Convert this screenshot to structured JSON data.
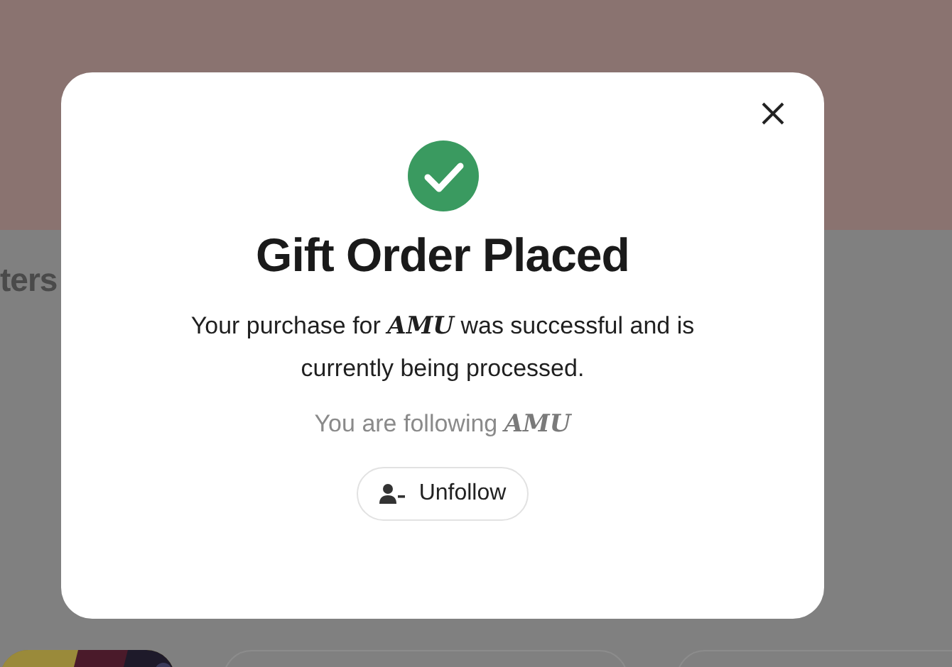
{
  "page": {
    "heading_fragment": "ters",
    "cards": [
      {
        "kind": "picture"
      },
      {
        "kind": "empty"
      },
      {
        "kind": "empty"
      }
    ]
  },
  "dialog": {
    "title": "Gift Order Placed",
    "message": "Your purchase for **AMU** was successful and is currently being processed.",
    "following_text": "You are following **AMU**",
    "button": "Unfollow"
  }
}
